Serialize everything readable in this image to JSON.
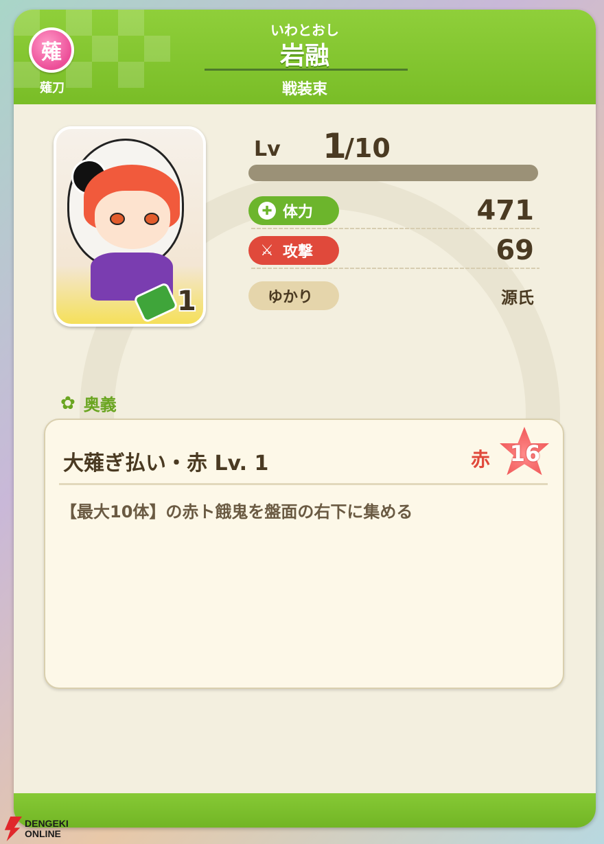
{
  "header": {
    "weapon_badge_char": "薙",
    "weapon_type": "薙刀",
    "name_reading": "いわとおし",
    "name": "岩融",
    "costume": "戦装束"
  },
  "portrait": {
    "copies": "1"
  },
  "level": {
    "label": "Lv",
    "current": "1",
    "max": "/10"
  },
  "stats": {
    "hp_label": "体力",
    "hp_value": "471",
    "atk_label": "攻撃",
    "atk_value": "69",
    "yukari_label": "ゆかり",
    "yukari_value": "源氏"
  },
  "ougi": {
    "section_title": "奥義",
    "skill_name": "大薙ぎ払い・赤 Lv. 1",
    "color_label": "赤",
    "cost": "16",
    "description": "【最大10体】の赤ト餓鬼を盤面の右下に集める"
  },
  "watermark": {
    "line1": "DENGEKI",
    "line2": "ONLINE"
  },
  "colors": {
    "header_green": "#79bd27",
    "hp_green": "#6cb52c",
    "atk_red": "#e0493b",
    "weapon_pink": "#ec4e98"
  }
}
